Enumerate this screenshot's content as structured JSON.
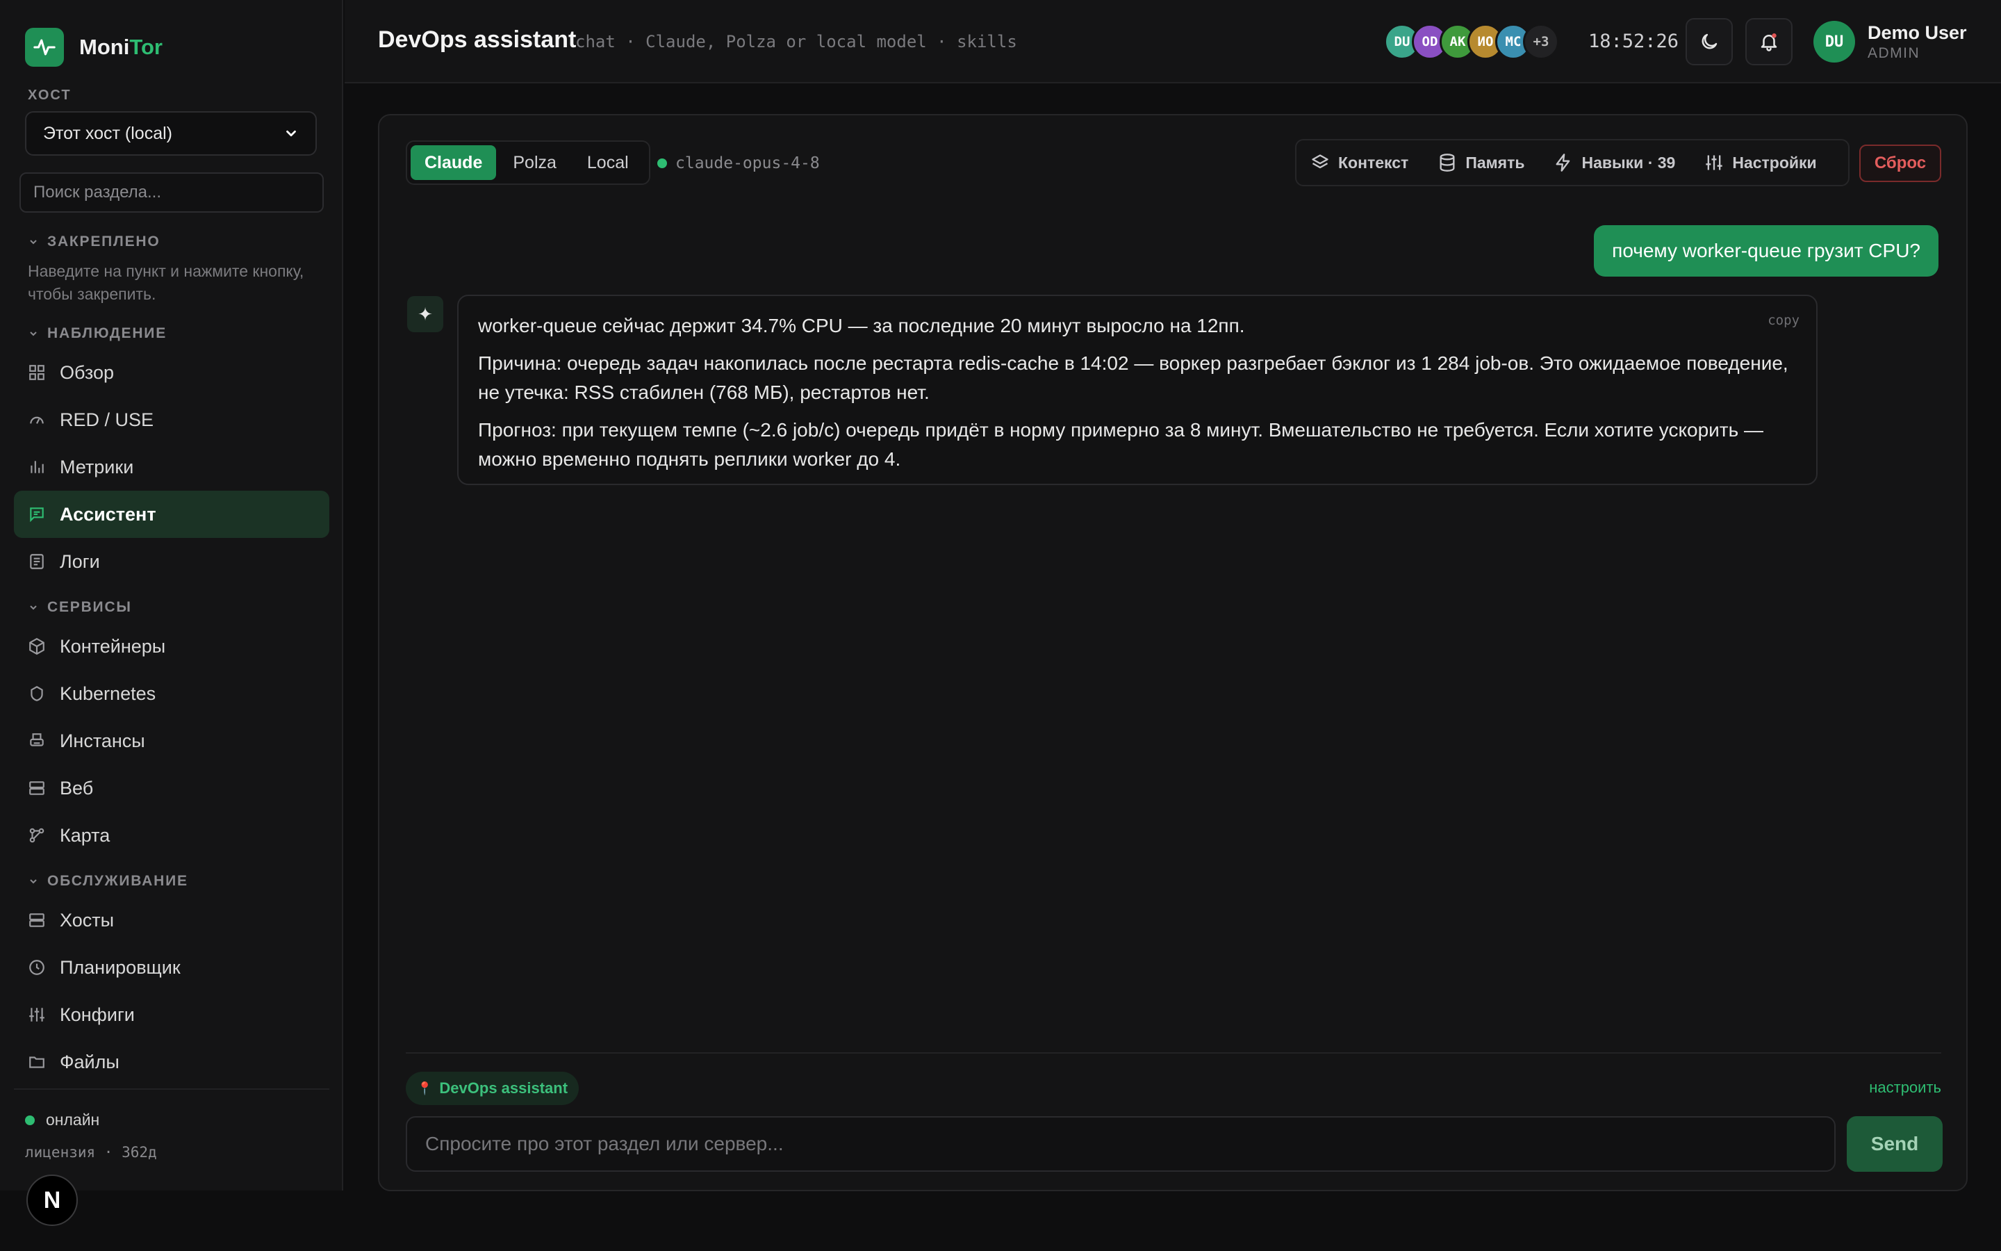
{
  "brand": {
    "name_main": "Moni",
    "name_accent": "Tor",
    "accent": "#2ebd72"
  },
  "host": {
    "label": "ХОСТ",
    "selected": "Этот хост (local)"
  },
  "section_search": {
    "placeholder": "Поиск раздела..."
  },
  "pinned": {
    "title": "ЗАКРЕПЛЕНО",
    "hint": "Наведите на пункт и нажмите кнопку, чтобы закрепить."
  },
  "nav": {
    "observe_title": "НАБЛЮДЕНИЕ",
    "observe": [
      {
        "label": "Обзор",
        "icon": "grid-icon"
      },
      {
        "label": "RED / USE",
        "icon": "gauge-icon"
      },
      {
        "label": "Метрики",
        "icon": "bar-chart-icon"
      },
      {
        "label": "Ассистент",
        "icon": "chat-icon",
        "active": true
      },
      {
        "label": "Логи",
        "icon": "list-icon"
      }
    ],
    "services_title": "СЕРВИСЫ",
    "services": [
      {
        "label": "Контейнеры",
        "icon": "box-icon"
      },
      {
        "label": "Kubernetes",
        "icon": "helm-icon"
      },
      {
        "label": "Инстансы",
        "icon": "printer-icon"
      },
      {
        "label": "Веб",
        "icon": "server-icon"
      },
      {
        "label": "Карта",
        "icon": "network-icon"
      }
    ],
    "maint_title": "ОБСЛУЖИВАНИЕ",
    "maint": [
      {
        "label": "Хосты",
        "icon": "server-icon"
      },
      {
        "label": "Планировщик",
        "icon": "clock-icon"
      },
      {
        "label": "Конфиги",
        "icon": "sliders-icon"
      },
      {
        "label": "Файлы",
        "icon": "folder-icon"
      }
    ]
  },
  "footer": {
    "status": "онлайн",
    "license": "лицензия  ·  362д",
    "badge": "N"
  },
  "header": {
    "title": "DevOps assistant",
    "subtitle": "chat · Claude, Polza or local model · skills",
    "avatars": [
      {
        "initials": "DU",
        "color": "#3aa58a"
      },
      {
        "initials": "OD",
        "color": "#8a4fc2"
      },
      {
        "initials": "AK",
        "color": "#3f9a3c"
      },
      {
        "initials": "ИО",
        "color": "#b78a2f"
      },
      {
        "initials": "MC",
        "color": "#3a8fb0"
      }
    ],
    "avatars_more": "+3",
    "clock": "18:52:26",
    "user": {
      "initials": "DU",
      "name": "Demo User",
      "role": "ADMIN"
    }
  },
  "chat": {
    "providers": [
      "Claude",
      "Polza",
      "Local"
    ],
    "active_provider": "Claude",
    "model": "claude-opus-4-8",
    "tools": {
      "context": "Контекст",
      "memory": "Память",
      "skills": "Навыки · 39",
      "settings": "Настройки"
    },
    "reset": "Сброс",
    "user_message": "почему worker-queue грузит CPU?",
    "assistant": {
      "copy": "copy",
      "p1": "worker-queue сейчас держит 34.7% CPU — за последние 20 минут выросло на 12пп.",
      "p2": "Причина: очередь задач накопилась после рестарта redis-cache в 14:02 — воркер разгребает бэклог из 1 284 job-ов. Это ожидаемое поведение, не утечка: RSS стабилен (768 МБ), рестартов нет.",
      "p3": "Прогноз: при текущем темпе (~2.6 job/с) очередь придёт в норму примерно за 8 минут. Вмешательство не требуется. Если хотите ускорить — можно временно поднять реплики worker до 4."
    },
    "context_chip": "DevOps assistant",
    "configure": "настроить",
    "input_placeholder": "Спросите про этот раздел или сервер...",
    "send": "Send"
  }
}
